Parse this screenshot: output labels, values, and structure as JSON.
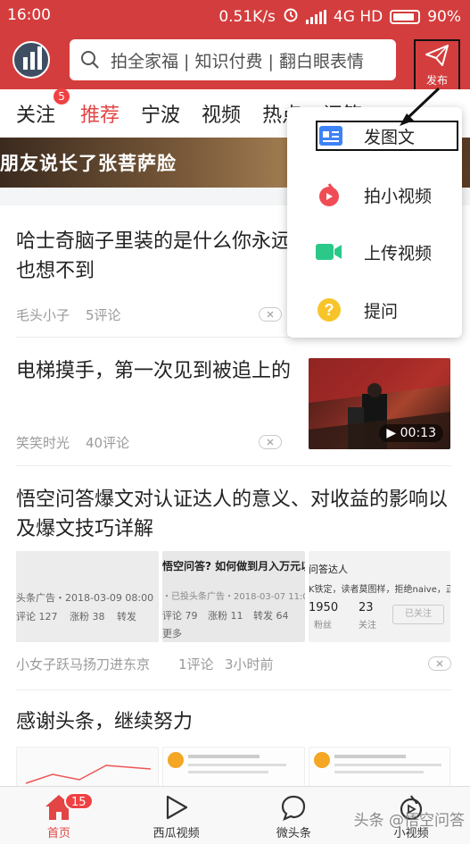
{
  "status": {
    "time": "16:00",
    "speed": "0.51K/s",
    "network": "4G HD",
    "battery": "90%"
  },
  "header": {
    "search_placeholder": "拍全家福 | 知识付费 | 翻白眼表情",
    "publish_label": "发布"
  },
  "tabs": [
    {
      "label": "关注",
      "badge": "5"
    },
    {
      "label": "推荐"
    },
    {
      "label": "宁波"
    },
    {
      "label": "视频"
    },
    {
      "label": "热点"
    },
    {
      "label": "问答"
    }
  ],
  "banner": {
    "text": "朋友说长了张菩萨脸"
  },
  "menu": {
    "items": [
      {
        "label": "发图文",
        "icon": "image-text-icon"
      },
      {
        "label": "拍小视频",
        "icon": "flame-video-icon"
      },
      {
        "label": "上传视频",
        "icon": "video-camera-icon"
      },
      {
        "label": "提问",
        "icon": "question-icon"
      }
    ]
  },
  "feed": [
    {
      "title": "哈士奇脑子里装的是什么你永远也想不到",
      "source": "毛头小子",
      "comments": "5评论"
    },
    {
      "title": "电梯摸手，第一次见到被追上的",
      "source": "笑笑时光",
      "comments": "40评论",
      "duration": "00:13"
    },
    {
      "title": "悟空问答爆文对认证达人的意义、对收益的影响以及爆文技巧详解",
      "source": "小女子跃马扬刀进东京",
      "comments": "1评论",
      "time": "3小时前",
      "thumbs": [
        {
          "l1": "头条广告・2018-03-09 08:00",
          "l2": "评论 127",
          "l3": "涨粉 38",
          "l4": "转发"
        },
        {
          "l1": "悟空问答? 如何做到月入万元以",
          "l2": "・已投头条广告・2018-03-07 11:00",
          "l3": "评论 79",
          "l4": "涨粉 11",
          "l5": "转发 64",
          "l6": "更多"
        },
        {
          "l1": "问答达人",
          "l2": "K铁定，读者莫图样，拒绝naive，正",
          "l3": "1950",
          "l4": "粉丝",
          "l5": "23",
          "l6": "关注",
          "l7": "已关注"
        }
      ]
    },
    {
      "title": "感谢头条，继续努力"
    }
  ],
  "bottom_nav": [
    {
      "label": "首页",
      "badge": "15"
    },
    {
      "label": "西瓜视频"
    },
    {
      "label": "微头条"
    },
    {
      "label": "小视频"
    }
  ],
  "watermark": "头条 @悟空问答"
}
